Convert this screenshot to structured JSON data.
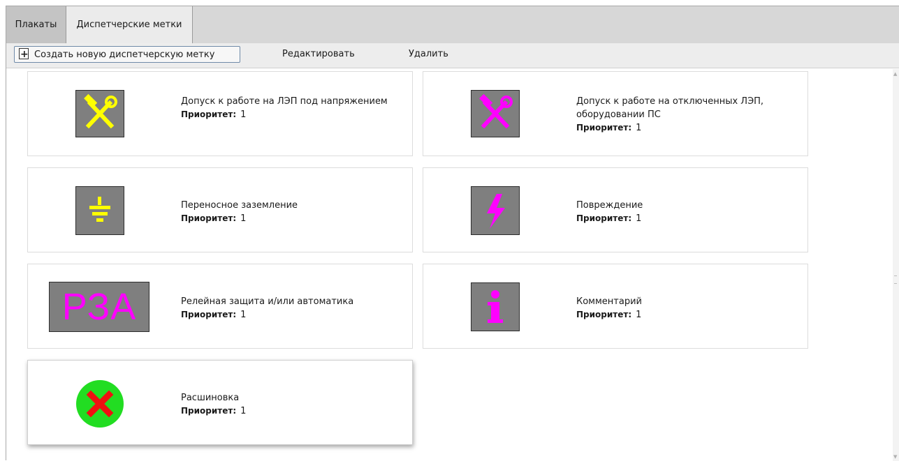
{
  "tabs": [
    {
      "label": "Плакаты"
    },
    {
      "label": "Диспетчерские метки"
    }
  ],
  "toolbar": {
    "create_label": "Создать новую диспетчерскую метку",
    "edit_label": "Редактировать",
    "delete_label": "Удалить"
  },
  "priority_label": "Приоритет:",
  "cards": [
    {
      "title": "Допуск к работе на ЛЭП под напряжением",
      "priority": "1",
      "icon": "hammer-wrench-icon",
      "icon_color": "#ffff00"
    },
    {
      "title": "Допуск к работе на отключенных ЛЭП, оборудовании ПС",
      "priority": "1",
      "icon": "hammer-wrench-icon",
      "icon_color": "#ff00ff"
    },
    {
      "title": "Переносное заземление",
      "priority": "1",
      "icon": "ground-icon",
      "icon_color": "#ffff00"
    },
    {
      "title": "Повреждение",
      "priority": "1",
      "icon": "lightning-icon",
      "icon_color": "#ff00ff"
    },
    {
      "title": "Релейная защита и/или автоматика",
      "priority": "1",
      "icon": "rza-icon",
      "icon_text": "РЗА",
      "icon_color": "#ff00ff"
    },
    {
      "title": "Комментарий",
      "priority": "1",
      "icon": "info-icon",
      "icon_color": "#ff00ff"
    },
    {
      "title": "Расшиновка",
      "priority": "1",
      "icon": "red-cross-green-circle-icon",
      "icon_color": "#ff0000"
    }
  ]
}
